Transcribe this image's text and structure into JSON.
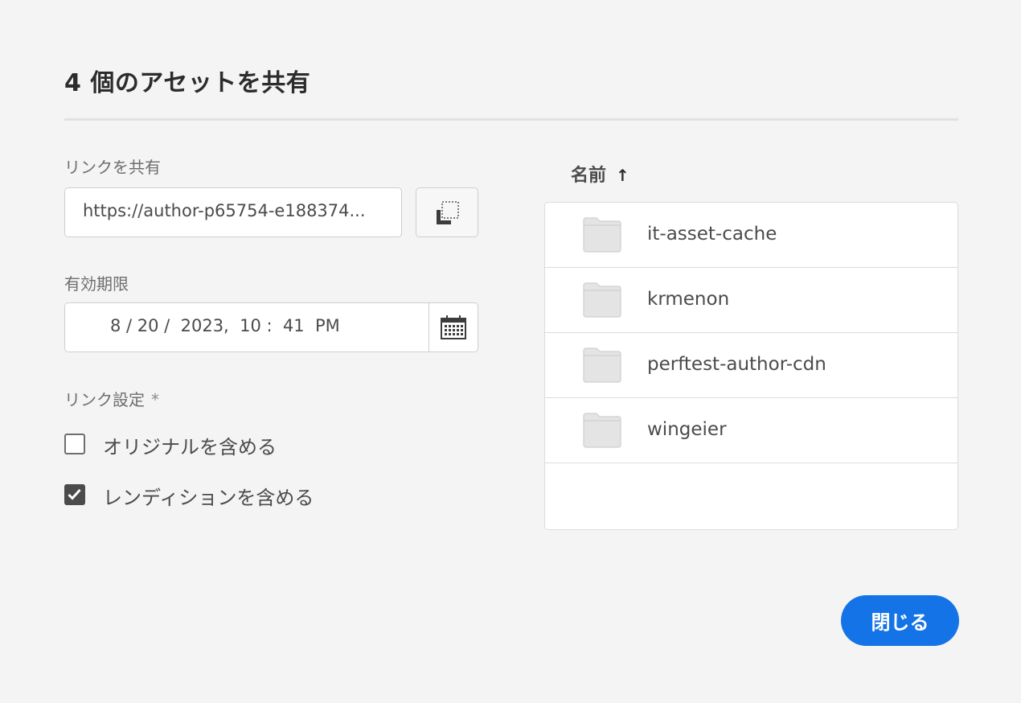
{
  "dialog": {
    "title": "4 個のアセットを共有",
    "share_link": {
      "label": "リンクを共有",
      "value": "https://author-p65754-e188374...",
      "copy_icon": "copy-icon"
    },
    "expiration": {
      "label": "有効期限",
      "value": "8 / 20 /  2023,  10 :  41  PM",
      "calendar_icon": "calendar-icon"
    },
    "link_settings": {
      "label": "リンク設定",
      "required_marker": "*",
      "options": [
        {
          "label": "オリジナルを含める",
          "checked": false
        },
        {
          "label": "レンディションを含める",
          "checked": true
        }
      ]
    },
    "asset_list": {
      "column_header": "名前",
      "sort_icon": "arrow-up-icon",
      "items": [
        {
          "name": "it-asset-cache",
          "icon": "folder-icon"
        },
        {
          "name": "krmenon",
          "icon": "folder-icon"
        },
        {
          "name": "perftest-author-cdn",
          "icon": "folder-icon"
        },
        {
          "name": "wingeier",
          "icon": "folder-icon"
        }
      ]
    },
    "close_label": "閉じる"
  },
  "colors": {
    "background": "#f4f4f4",
    "accent": "#1473e6",
    "checkbox_checked": "#4b4b4b"
  }
}
